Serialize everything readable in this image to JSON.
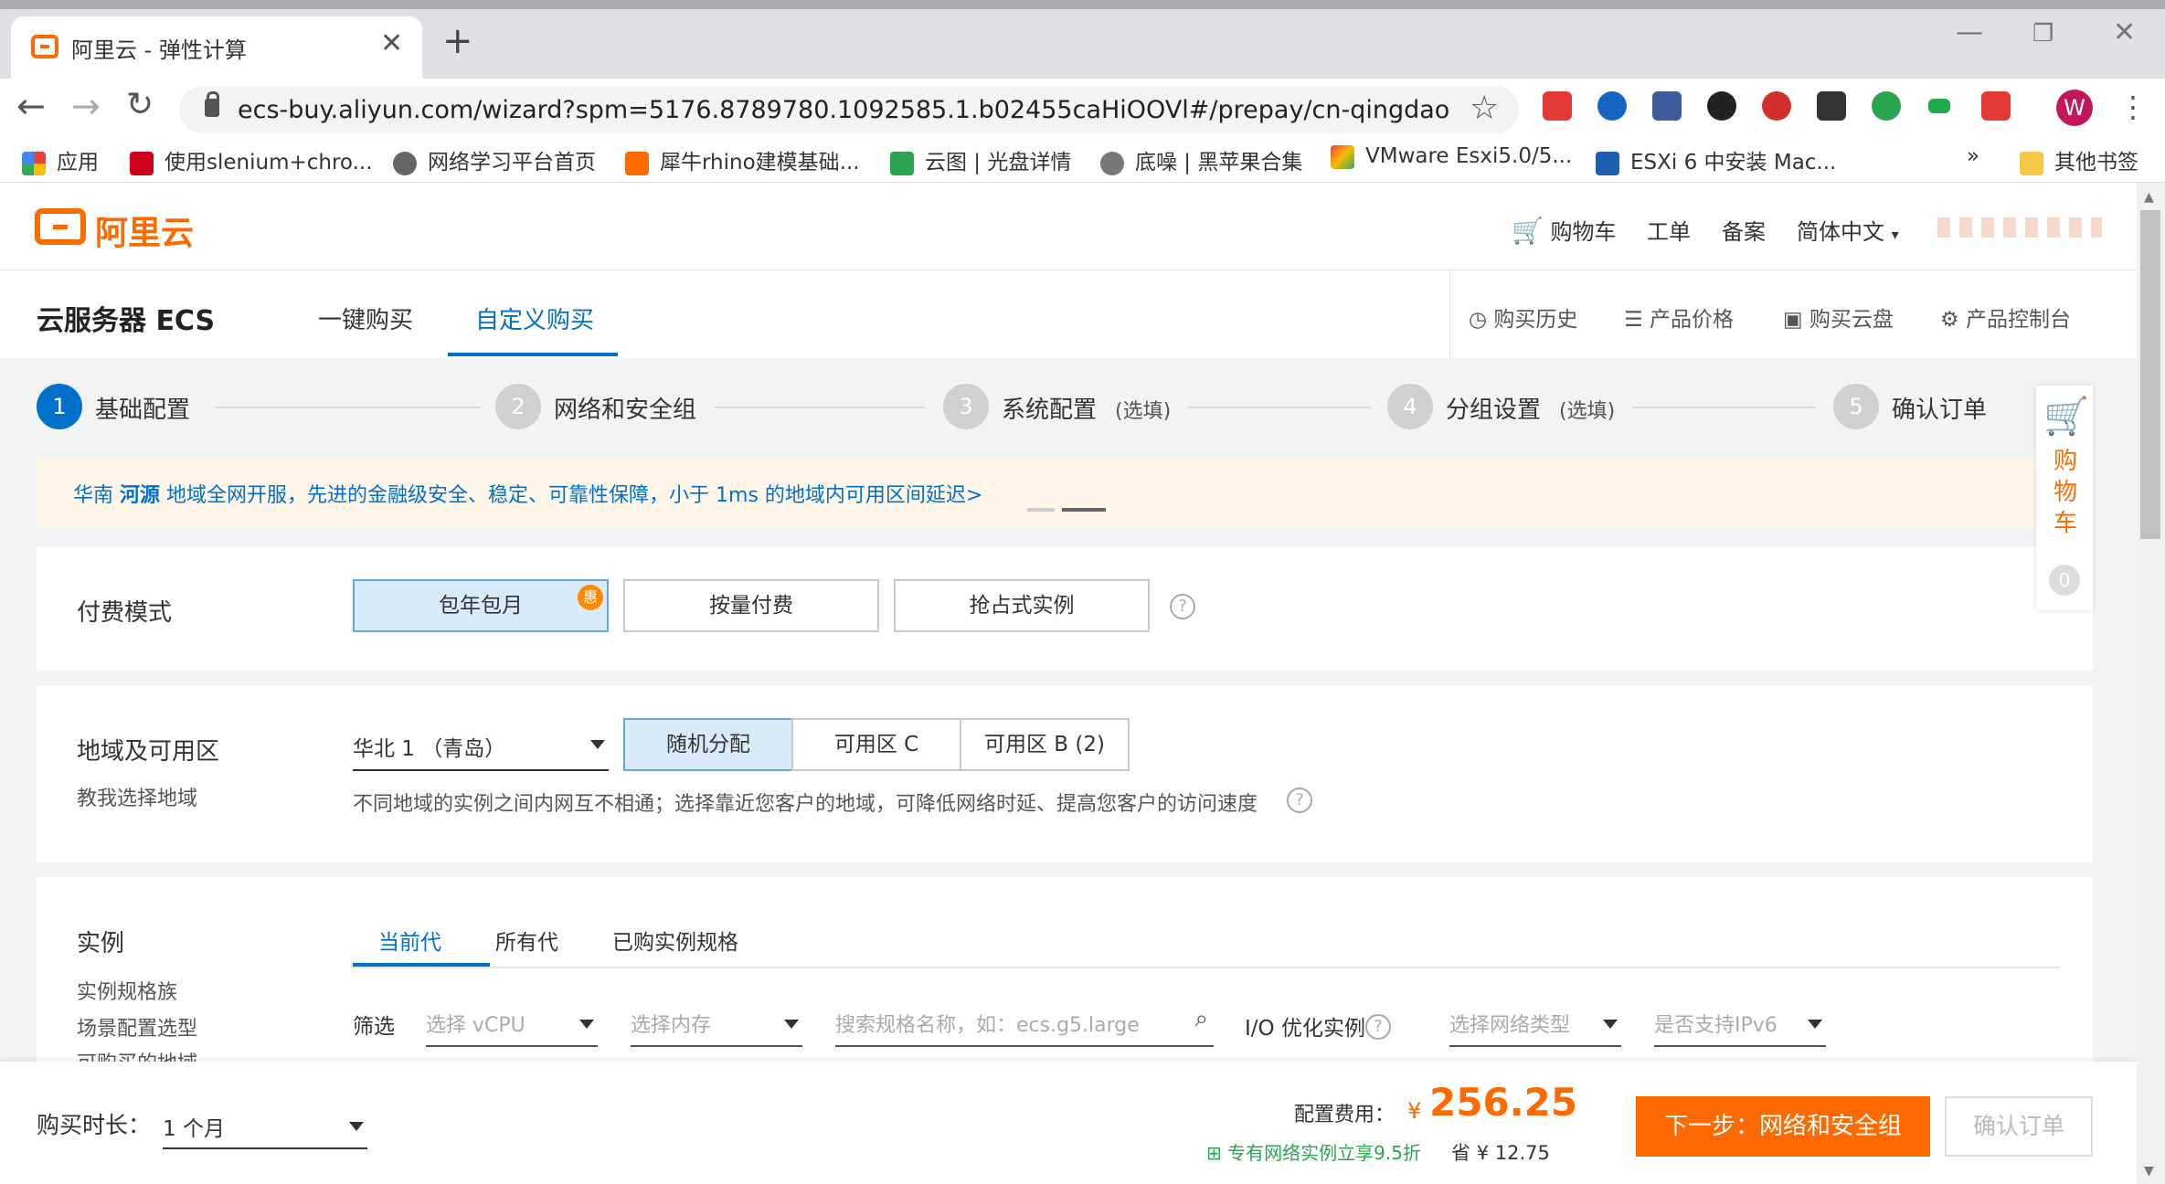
{
  "browser": {
    "tab_title": "阿里云 - 弹性计算",
    "url": "ecs-buy.aliyun.com/wizard?spm=5176.8789780.1092585.1.b02455caHiOOVl#/prepay/cn-qingdao",
    "profile_initial": "W",
    "bookmarks": [
      {
        "label": "应用",
        "color": "#e94235"
      },
      {
        "label": "使用slenium+chro...",
        "color": "#d0021b"
      },
      {
        "label": "网络学习平台首页",
        "color": "#666666"
      },
      {
        "label": "犀牛rhino建模基础...",
        "color": "#ff6a00"
      },
      {
        "label": "云图 | 光盘详情",
        "color": "#2aa44f"
      },
      {
        "label": "底噪 | 黑苹果合集",
        "color": "#777777"
      },
      {
        "label": "VMware Esxi5.0/5...",
        "color": "#e94235"
      },
      {
        "label": "ESXi 6 中安装 Mac...",
        "color": "#1e5fb4"
      }
    ],
    "bookmarks_more": "»",
    "other_bookmarks": "其他书签"
  },
  "header": {
    "logo_text": "阿里云",
    "cart": "购物车",
    "ticket": "工单",
    "filing": "备案",
    "language": "简体中文"
  },
  "subheader": {
    "title": "云服务器 ECS",
    "tabs": [
      "一键购买",
      "自定义购买"
    ],
    "links": [
      "购买历史",
      "产品价格",
      "购买云盘",
      "产品控制台"
    ]
  },
  "steps": [
    {
      "num": "1",
      "label": "基础配置",
      "optional": ""
    },
    {
      "num": "2",
      "label": "网络和安全组",
      "optional": ""
    },
    {
      "num": "3",
      "label": "系统配置",
      "optional": "(选填)"
    },
    {
      "num": "4",
      "label": "分组设置",
      "optional": "(选填)"
    },
    {
      "num": "5",
      "label": "确认订单",
      "optional": ""
    }
  ],
  "notice": {
    "region": "华南",
    "city": "河源",
    "text": "地域全网开服，先进的金融级安全、稳定、可靠性保障，小于 1ms 的地域内可用区间延迟>"
  },
  "billing": {
    "label": "付费模式",
    "options": [
      "包年包月",
      "按量付费",
      "抢占式实例"
    ],
    "badge": "惠"
  },
  "region": {
    "label": "地域及可用区",
    "sub": "教我选择地域",
    "selected": "华北 1 （青岛）",
    "zones": [
      "随机分配",
      "可用区 C",
      "可用区 B (2)"
    ],
    "hint": "不同地域的实例之间内网互不相通；选择靠近您客户的地域，可降低网络时延、提高您客户的访问速度"
  },
  "instance": {
    "label": "实例",
    "side_links": [
      "实例规格族",
      "场景配置选型",
      "可购买的地域"
    ],
    "tabs": [
      "当前代",
      "所有代",
      "已购实例规格"
    ],
    "filter_label": "筛选",
    "vcpu_placeholder": "选择 vCPU",
    "memory_placeholder": "选择内存",
    "search_placeholder": "搜索规格名称，如：ecs.g5.large",
    "io_label": "I/O 优化实例",
    "network_placeholder": "选择网络类型",
    "ipv6_placeholder": "是否支持IPv6"
  },
  "cart_panel": {
    "label": "购物车",
    "count": "0"
  },
  "footer": {
    "duration_label": "购买时长：",
    "duration_value": "1 个月",
    "cost_label": "配置费用：",
    "currency": "¥",
    "price": "256.25",
    "promo": "专有网络实例立享9.5折",
    "save_label": "省",
    "save_amount": "¥ 12.75",
    "next_button": "下一步：网络和安全组",
    "confirm_button": "确认订单"
  },
  "colors": {
    "accent": "#ff6a00",
    "primary": "#0070cc",
    "promo": "#2aa44f"
  }
}
